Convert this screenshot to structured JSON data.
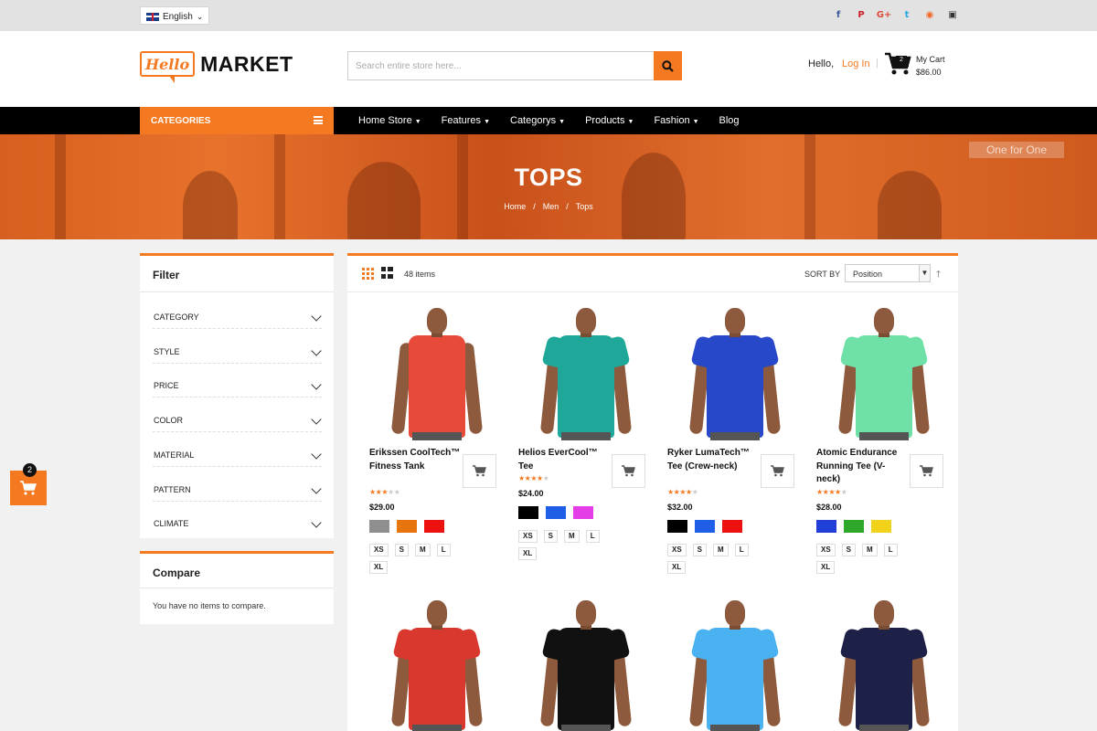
{
  "topbar": {
    "language": "English",
    "socials": [
      {
        "name": "facebook-icon",
        "glyph": "f",
        "color": "#3b5998"
      },
      {
        "name": "pinterest-icon",
        "glyph": "P",
        "color": "#cb2027"
      },
      {
        "name": "google-plus-icon",
        "glyph": "G+",
        "color": "#dd4b39"
      },
      {
        "name": "twitter-icon",
        "glyph": "t",
        "color": "#2aa9e0"
      },
      {
        "name": "rss-icon",
        "glyph": "◉",
        "color": "#f26522"
      },
      {
        "name": "instagram-icon",
        "glyph": "▣",
        "color": "#333333"
      }
    ]
  },
  "header": {
    "logo_script": "Hello",
    "logo_text": "MARKET",
    "search_placeholder": "Search entire store here...",
    "hello": "Hello,",
    "login": "Log In",
    "separator": "|",
    "cart_count": "2",
    "cart_label": "My Cart",
    "cart_total": "$86.00"
  },
  "nav": {
    "categories": "CATEGORIES",
    "items": [
      "Home Store",
      "Features",
      "Categorys",
      "Products",
      "Fashion",
      "Blog"
    ]
  },
  "banner": {
    "title": "TOPS",
    "crumbs": [
      "Home",
      "Men",
      "Tops"
    ],
    "crumb_separator": "/",
    "sign_text": "One for One"
  },
  "sidebar": {
    "filter_title": "Filter",
    "filters": [
      "CATEGORY",
      "STYLE",
      "PRICE",
      "COLOR",
      "MATERIAL",
      "PATTERN",
      "CLIMATE"
    ],
    "compare_title": "Compare",
    "compare_text": "You have no items to compare."
  },
  "floating_cart": {
    "count": "2"
  },
  "toolbar": {
    "items_count": "48 items",
    "sort_label": "SORT BY",
    "sort_value": "Position"
  },
  "colors": {
    "accent": "#f47921",
    "nav_bg": "#000000"
  },
  "products": [
    {
      "name": "Erikssen CoolTech™ Fitness Tank",
      "rating": 3,
      "price": "$29.00",
      "shirt_color": "#e84a3a",
      "sleeveless": true,
      "swatches": [
        "#8f8f8f",
        "#e8740e",
        "#ee1111"
      ],
      "sizes": [
        "XS",
        "S",
        "M",
        "L",
        "XL"
      ]
    },
    {
      "name": "Helios EverCool™ Tee",
      "rating": 4,
      "price": "$24.00",
      "shirt_color": "#1fa89a",
      "sleeveless": false,
      "swatches": [
        "#000000",
        "#1f5fe8",
        "#e43ee8"
      ],
      "sizes": [
        "XS",
        "S",
        "M",
        "L",
        "XL"
      ]
    },
    {
      "name": "Ryker LumaTech™ Tee (Crew-neck)",
      "rating": 4,
      "price": "$32.00",
      "shirt_color": "#2748c9",
      "sleeveless": false,
      "swatches": [
        "#000000",
        "#1f5fe8",
        "#ee1111"
      ],
      "sizes": [
        "XS",
        "S",
        "M",
        "L",
        "XL"
      ]
    },
    {
      "name": "Atomic Endurance Running Tee (V-neck)",
      "rating": 4,
      "price": "$28.00",
      "shirt_color": "#6ee0a8",
      "sleeveless": false,
      "swatches": [
        "#1f3fd8",
        "#2ea82a",
        "#f2d21a"
      ],
      "sizes": [
        "XS",
        "S",
        "M",
        "L",
        "XL"
      ]
    }
  ],
  "products_row2": [
    {
      "shirt_color": "#d9382f"
    },
    {
      "shirt_color": "#111111"
    },
    {
      "shirt_color": "#4ab2f0"
    },
    {
      "shirt_color": "#1d2147"
    }
  ]
}
